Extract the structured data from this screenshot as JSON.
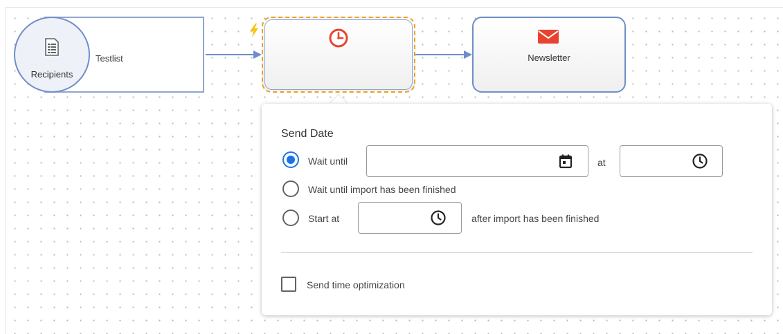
{
  "nodes": {
    "recipients": {
      "label": "Recipients",
      "list_name": "Testlist",
      "icon": "list-document-icon"
    },
    "wait": {
      "icon": "clock-icon",
      "trigger_icon": "lightning-bolt-icon",
      "accent": "#f0a024"
    },
    "newsletter": {
      "label": "Newsletter",
      "icon": "mail-envelope-icon",
      "icon_color": "#e8432e"
    }
  },
  "send_date_popup": {
    "title": "Send Date",
    "options": {
      "wait_until": {
        "label": "Wait until",
        "selected": true,
        "date_value": "",
        "at_label": "at",
        "time_value": ""
      },
      "wait_import": {
        "label": "Wait until import has been finished",
        "selected": false
      },
      "start_at": {
        "label": "Start at",
        "selected": false,
        "time_value": "",
        "suffix": "after import has been finished"
      }
    },
    "send_time_optimization": {
      "label": "Send time optimization",
      "checked": false
    }
  },
  "colors": {
    "connector": "#6f8ec7",
    "radio_selected": "#1a73e8",
    "clock_red": "#e8432e"
  }
}
